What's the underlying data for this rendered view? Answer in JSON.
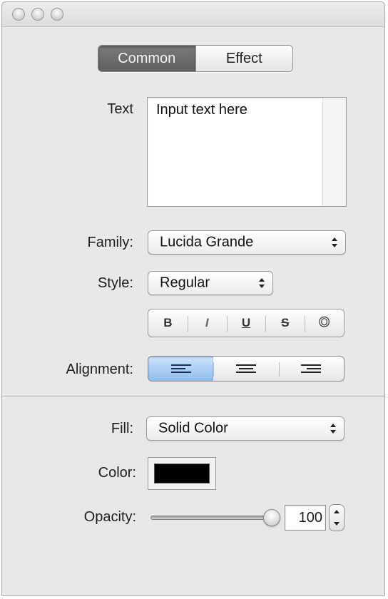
{
  "tabs": {
    "common": "Common",
    "effect": "Effect",
    "selected": "Common"
  },
  "text_section": {
    "label": "Text",
    "value": "Input text here"
  },
  "family": {
    "label": "Family:",
    "value": "Lucida Grande"
  },
  "style": {
    "label": "Style:",
    "value": "Regular"
  },
  "format_buttons": {
    "bold": "B",
    "italic": "I",
    "underline": "U",
    "strikethrough": "S",
    "outline": "O"
  },
  "alignment": {
    "label": "Alignment:",
    "options": [
      "left",
      "center",
      "right"
    ],
    "selected": "left"
  },
  "fill": {
    "label": "Fill:",
    "value": "Solid Color"
  },
  "color": {
    "label": "Color:",
    "value": "#000000"
  },
  "opacity": {
    "label": "Opacity:",
    "value": "100",
    "level": 100
  },
  "colors": {
    "selection_blue": "#8fbdee",
    "window_bg": "#e8e8e8"
  }
}
